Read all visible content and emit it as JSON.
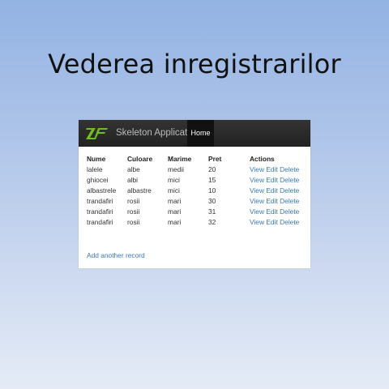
{
  "slide": {
    "title": "Vederea inregistrarilor"
  },
  "navbar": {
    "logo": "ZF",
    "brand": "Skeleton Application",
    "home": "Home"
  },
  "table": {
    "headers": [
      "Nume",
      "Culoare",
      "Marime",
      "Pret",
      "Actions"
    ],
    "rows": [
      [
        "lalele",
        "albe",
        "medii",
        "20"
      ],
      [
        "ghiocei",
        "albi",
        "mici",
        "15"
      ],
      [
        "albastrele",
        "albastre",
        "mici",
        "10"
      ],
      [
        "trandafiri",
        "rosii",
        "mari",
        "30"
      ],
      [
        "trandafiri",
        "rosii",
        "mari",
        "31"
      ],
      [
        "trandafiri",
        "rosii",
        "mari",
        "32"
      ]
    ],
    "actions": {
      "view": "View",
      "edit": "Edit",
      "delete": "Delete"
    }
  },
  "add_link": "Add another record",
  "colors": {
    "logo_green": "#6fbf1f",
    "link_blue": "#3a7ab3",
    "navbar": "#222222"
  }
}
